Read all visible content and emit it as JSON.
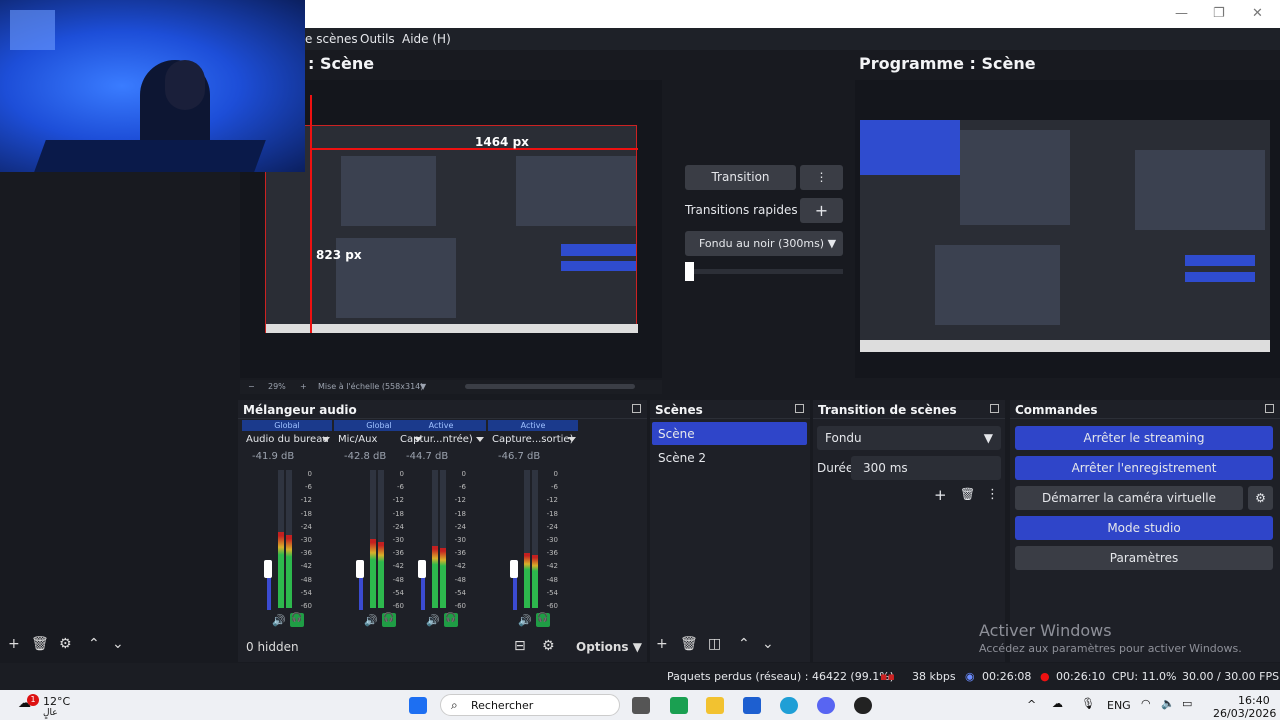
{
  "menu": {
    "scenes": "e scènes",
    "tools": "Outils",
    "help": "Aide (H)"
  },
  "preview": {
    "title": ": Scène",
    "width_label": "1464 px",
    "height_label": "823 px",
    "zoom": "29%",
    "scale_mode": "Mise à l'échelle (558x314)"
  },
  "program": {
    "title": "Programme : Scène"
  },
  "transition_panel": {
    "transition_label": "Transition",
    "quick_label": "Transitions rapides",
    "fade_label": "Fondu au noir (300ms)"
  },
  "audio_mixer": {
    "title": "Mélangeur audio",
    "channels": [
      {
        "badge": "Global",
        "name": "Audio du bureau",
        "db": "-41.9 dB",
        "level": 0.55
      },
      {
        "badge": "Global",
        "name": "Mic/Aux",
        "db": "-42.8 dB",
        "level": 0.5
      },
      {
        "badge": "Active",
        "name": "Captur...ntrée)",
        "db": "-44.7 dB",
        "level": 0.45
      },
      {
        "badge": "Active",
        "name": "Capture...sortie)",
        "db": "-46.7 dB",
        "level": 0.4
      }
    ],
    "scale": [
      "0",
      "-6",
      "-12",
      "-18",
      "-24",
      "-30",
      "-36",
      "-42",
      "-48",
      "-54",
      "-60"
    ],
    "hidden": "0 hidden",
    "options": "Options"
  },
  "scenes": {
    "title": "Scènes",
    "items": [
      "Scène",
      "Scène 2"
    ]
  },
  "scene_transition": {
    "title": "Transition de scènes",
    "type": "Fondu",
    "duration_label": "Durée",
    "duration": "300 ms"
  },
  "controls": {
    "title": "Commandes",
    "stop_stream": "Arrêter le streaming",
    "stop_record": "Arrêter l'enregistrement",
    "virtual_cam": "Démarrer la caméra virtuelle",
    "studio": "Mode studio",
    "settings": "Paramètres"
  },
  "watermark": {
    "line1": "Activer Windows",
    "line2": "Accédez aux paramètres pour activer Windows."
  },
  "status": {
    "dropped": "Paquets perdus (réseau) : 46422 (99.1%)",
    "kbps": "38 kbps",
    "stream_time": "00:26:08",
    "rec_time": "00:26:10",
    "cpu": "CPU: 11.0%",
    "fps": "30.00 / 30.00 FPS"
  },
  "taskbar": {
    "temp": "12°C",
    "weather": "عالٍ",
    "search": "Rechercher",
    "lang": "ENG",
    "time": "16:40",
    "date": "26/03/2026",
    "badge": "1"
  }
}
